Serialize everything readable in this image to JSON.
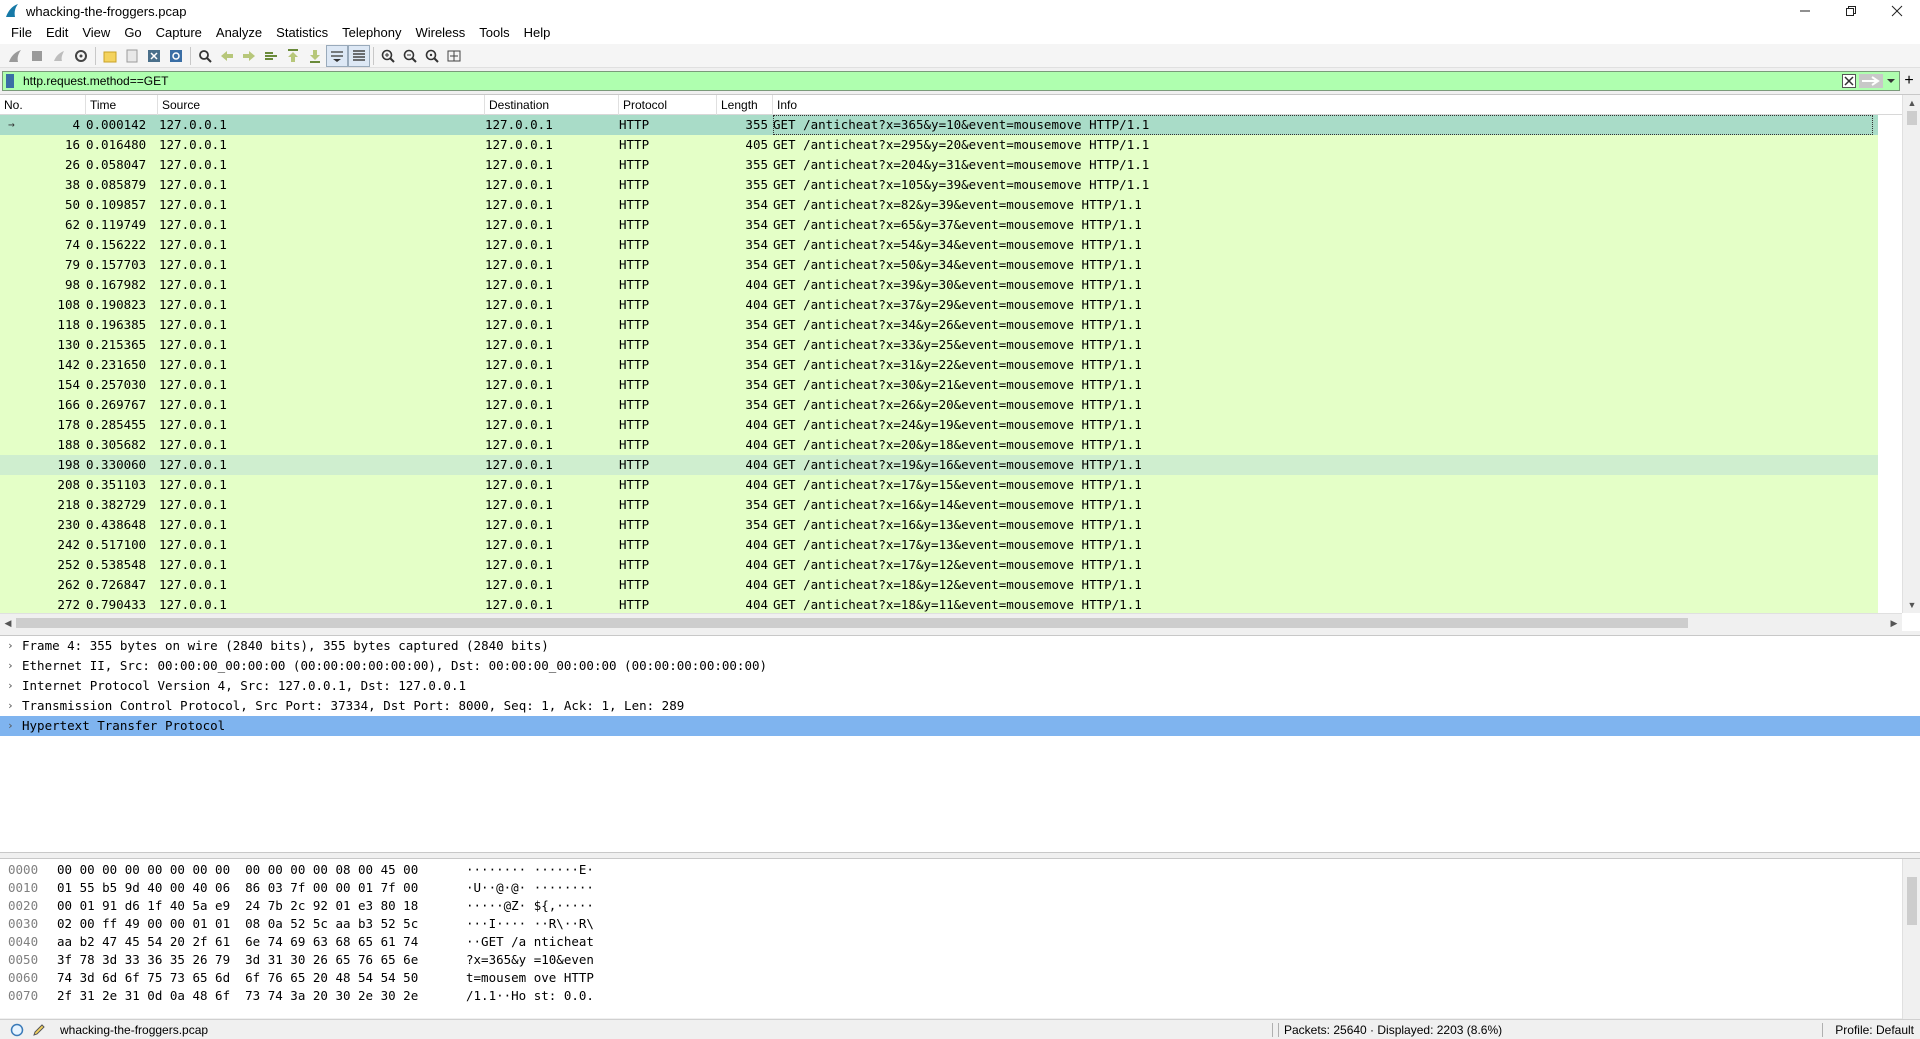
{
  "window": {
    "title": "whacking-the-froggers.pcap",
    "controls": [
      "minimize",
      "maximize",
      "close"
    ]
  },
  "menu": [
    "File",
    "Edit",
    "View",
    "Go",
    "Capture",
    "Analyze",
    "Statistics",
    "Telephony",
    "Wireless",
    "Tools",
    "Help"
  ],
  "filter": {
    "value": "http.request.method==GET",
    "background": "#afffaf"
  },
  "packet_list": {
    "columns": [
      "No.",
      "Time",
      "Source",
      "Destination",
      "Protocol",
      "Length",
      "Info"
    ],
    "selected_index": 0,
    "highlighted_index": 17,
    "rows": [
      {
        "no": "4",
        "time": "0.000142",
        "src": "127.0.0.1",
        "dst": "127.0.0.1",
        "proto": "HTTP",
        "len": "355",
        "info": "GET /anticheat?x=365&y=10&event=mousemove HTTP/1.1"
      },
      {
        "no": "16",
        "time": "0.016480",
        "src": "127.0.0.1",
        "dst": "127.0.0.1",
        "proto": "HTTP",
        "len": "405",
        "info": "GET /anticheat?x=295&y=20&event=mousemove HTTP/1.1"
      },
      {
        "no": "26",
        "time": "0.058047",
        "src": "127.0.0.1",
        "dst": "127.0.0.1",
        "proto": "HTTP",
        "len": "355",
        "info": "GET /anticheat?x=204&y=31&event=mousemove HTTP/1.1"
      },
      {
        "no": "38",
        "time": "0.085879",
        "src": "127.0.0.1",
        "dst": "127.0.0.1",
        "proto": "HTTP",
        "len": "355",
        "info": "GET /anticheat?x=105&y=39&event=mousemove HTTP/1.1"
      },
      {
        "no": "50",
        "time": "0.109857",
        "src": "127.0.0.1",
        "dst": "127.0.0.1",
        "proto": "HTTP",
        "len": "354",
        "info": "GET /anticheat?x=82&y=39&event=mousemove HTTP/1.1"
      },
      {
        "no": "62",
        "time": "0.119749",
        "src": "127.0.0.1",
        "dst": "127.0.0.1",
        "proto": "HTTP",
        "len": "354",
        "info": "GET /anticheat?x=65&y=37&event=mousemove HTTP/1.1"
      },
      {
        "no": "74",
        "time": "0.156222",
        "src": "127.0.0.1",
        "dst": "127.0.0.1",
        "proto": "HTTP",
        "len": "354",
        "info": "GET /anticheat?x=54&y=34&event=mousemove HTTP/1.1"
      },
      {
        "no": "79",
        "time": "0.157703",
        "src": "127.0.0.1",
        "dst": "127.0.0.1",
        "proto": "HTTP",
        "len": "354",
        "info": "GET /anticheat?x=50&y=34&event=mousemove HTTP/1.1"
      },
      {
        "no": "98",
        "time": "0.167982",
        "src": "127.0.0.1",
        "dst": "127.0.0.1",
        "proto": "HTTP",
        "len": "404",
        "info": "GET /anticheat?x=39&y=30&event=mousemove HTTP/1.1"
      },
      {
        "no": "108",
        "time": "0.190823",
        "src": "127.0.0.1",
        "dst": "127.0.0.1",
        "proto": "HTTP",
        "len": "404",
        "info": "GET /anticheat?x=37&y=29&event=mousemove HTTP/1.1"
      },
      {
        "no": "118",
        "time": "0.196385",
        "src": "127.0.0.1",
        "dst": "127.0.0.1",
        "proto": "HTTP",
        "len": "354",
        "info": "GET /anticheat?x=34&y=26&event=mousemove HTTP/1.1"
      },
      {
        "no": "130",
        "time": "0.215365",
        "src": "127.0.0.1",
        "dst": "127.0.0.1",
        "proto": "HTTP",
        "len": "354",
        "info": "GET /anticheat?x=33&y=25&event=mousemove HTTP/1.1"
      },
      {
        "no": "142",
        "time": "0.231650",
        "src": "127.0.0.1",
        "dst": "127.0.0.1",
        "proto": "HTTP",
        "len": "354",
        "info": "GET /anticheat?x=31&y=22&event=mousemove HTTP/1.1"
      },
      {
        "no": "154",
        "time": "0.257030",
        "src": "127.0.0.1",
        "dst": "127.0.0.1",
        "proto": "HTTP",
        "len": "354",
        "info": "GET /anticheat?x=30&y=21&event=mousemove HTTP/1.1"
      },
      {
        "no": "166",
        "time": "0.269767",
        "src": "127.0.0.1",
        "dst": "127.0.0.1",
        "proto": "HTTP",
        "len": "354",
        "info": "GET /anticheat?x=26&y=20&event=mousemove HTTP/1.1"
      },
      {
        "no": "178",
        "time": "0.285455",
        "src": "127.0.0.1",
        "dst": "127.0.0.1",
        "proto": "HTTP",
        "len": "404",
        "info": "GET /anticheat?x=24&y=19&event=mousemove HTTP/1.1"
      },
      {
        "no": "188",
        "time": "0.305682",
        "src": "127.0.0.1",
        "dst": "127.0.0.1",
        "proto": "HTTP",
        "len": "404",
        "info": "GET /anticheat?x=20&y=18&event=mousemove HTTP/1.1"
      },
      {
        "no": "198",
        "time": "0.330060",
        "src": "127.0.0.1",
        "dst": "127.0.0.1",
        "proto": "HTTP",
        "len": "404",
        "info": "GET /anticheat?x=19&y=16&event=mousemove HTTP/1.1"
      },
      {
        "no": "208",
        "time": "0.351103",
        "src": "127.0.0.1",
        "dst": "127.0.0.1",
        "proto": "HTTP",
        "len": "404",
        "info": "GET /anticheat?x=17&y=15&event=mousemove HTTP/1.1"
      },
      {
        "no": "218",
        "time": "0.382729",
        "src": "127.0.0.1",
        "dst": "127.0.0.1",
        "proto": "HTTP",
        "len": "354",
        "info": "GET /anticheat?x=16&y=14&event=mousemove HTTP/1.1"
      },
      {
        "no": "230",
        "time": "0.438648",
        "src": "127.0.0.1",
        "dst": "127.0.0.1",
        "proto": "HTTP",
        "len": "354",
        "info": "GET /anticheat?x=16&y=13&event=mousemove HTTP/1.1"
      },
      {
        "no": "242",
        "time": "0.517100",
        "src": "127.0.0.1",
        "dst": "127.0.0.1",
        "proto": "HTTP",
        "len": "404",
        "info": "GET /anticheat?x=17&y=13&event=mousemove HTTP/1.1"
      },
      {
        "no": "252",
        "time": "0.538548",
        "src": "127.0.0.1",
        "dst": "127.0.0.1",
        "proto": "HTTP",
        "len": "404",
        "info": "GET /anticheat?x=17&y=12&event=mousemove HTTP/1.1"
      },
      {
        "no": "262",
        "time": "0.726847",
        "src": "127.0.0.1",
        "dst": "127.0.0.1",
        "proto": "HTTP",
        "len": "404",
        "info": "GET /anticheat?x=18&y=12&event=mousemove HTTP/1.1"
      },
      {
        "no": "272",
        "time": "0.790433",
        "src": "127.0.0.1",
        "dst": "127.0.0.1",
        "proto": "HTTP",
        "len": "404",
        "info": "GET /anticheat?x=18&y=11&event=mousemove HTTP/1.1"
      }
    ],
    "row_color": "#e4ffc7",
    "selected_color": "#a9dcc8"
  },
  "details": {
    "selected_index": 4,
    "rows": [
      "Frame 4: 355 bytes on wire (2840 bits), 355 bytes captured (2840 bits)",
      "Ethernet II, Src: 00:00:00_00:00:00 (00:00:00:00:00:00), Dst: 00:00:00_00:00:00 (00:00:00:00:00:00)",
      "Internet Protocol Version 4, Src: 127.0.0.1, Dst: 127.0.0.1",
      "Transmission Control Protocol, Src Port: 37334, Dst Port: 8000, Seq: 1, Ack: 1, Len: 289",
      "Hypertext Transfer Protocol"
    ],
    "selected_color": "#7fb4ef"
  },
  "bytes": {
    "rows": [
      {
        "offset": "0000",
        "hex": "00 00 00 00 00 00 00 00  00 00 00 00 08 00 45 00",
        "ascii": "········ ······E·"
      },
      {
        "offset": "0010",
        "hex": "01 55 b5 9d 40 00 40 06  86 03 7f 00 00 01 7f 00",
        "ascii": "·U··@·@· ········"
      },
      {
        "offset": "0020",
        "hex": "00 01 91 d6 1f 40 5a e9  24 7b 2c 92 01 e3 80 18",
        "ascii": "·····@Z· ${,·····"
      },
      {
        "offset": "0030",
        "hex": "02 00 ff 49 00 00 01 01  08 0a 52 5c aa b3 52 5c",
        "ascii": "···I···· ··R\\··R\\"
      },
      {
        "offset": "0040",
        "hex": "aa b2 47 45 54 20 2f 61  6e 74 69 63 68 65 61 74",
        "ascii": "··GET /a nticheat"
      },
      {
        "offset": "0050",
        "hex": "3f 78 3d 33 36 35 26 79  3d 31 30 26 65 76 65 6e",
        "ascii": "?x=365&y =10&even"
      },
      {
        "offset": "0060",
        "hex": "74 3d 6d 6f 75 73 65 6d  6f 76 65 20 48 54 54 50",
        "ascii": "t=mousem ove HTTP"
      },
      {
        "offset": "0070",
        "hex": "2f 31 2e 31 0d 0a 48 6f  73 74 3a 20 30 2e 30 2e",
        "ascii": "/1.1··Ho st: 0.0."
      }
    ]
  },
  "status": {
    "file": "whacking-the-froggers.pcap",
    "packets": "Packets: 25640 · Displayed: 2203 (8.6%)",
    "profile": "Profile: Default"
  }
}
